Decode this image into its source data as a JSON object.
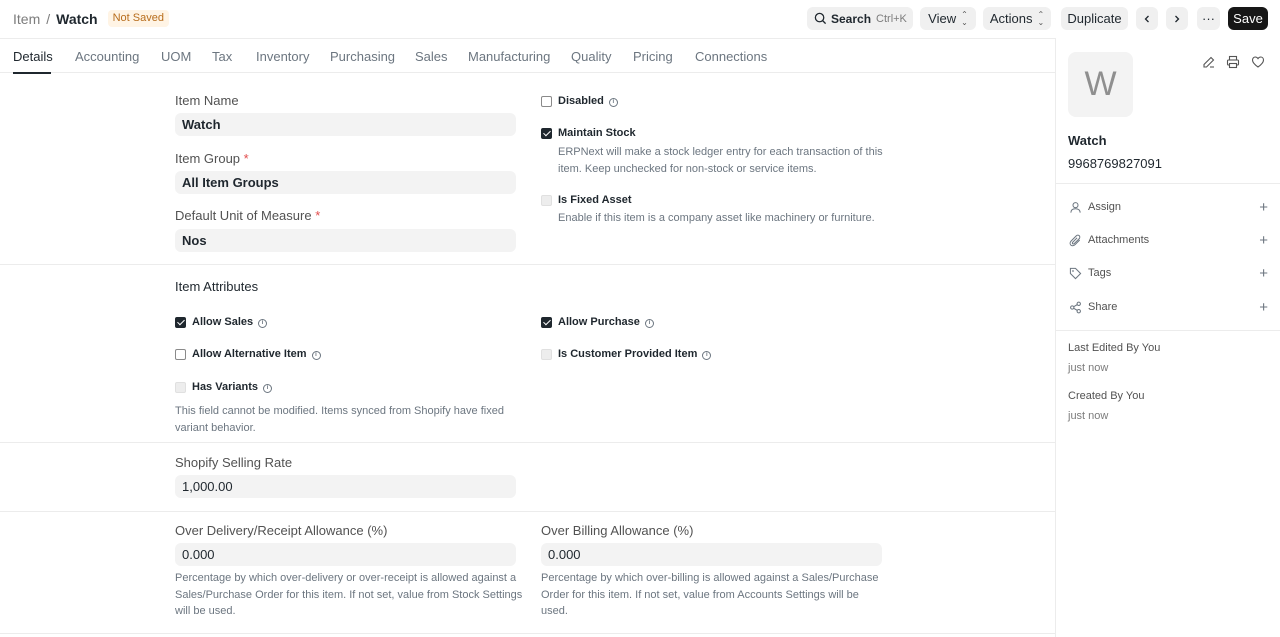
{
  "breadcrumb": {
    "parent": "Item",
    "separator": "/",
    "current": "Watch",
    "status": "Not Saved"
  },
  "toolbar": {
    "search_label": "Search",
    "search_shortcut": "Ctrl+K",
    "view_label": "View",
    "actions_label": "Actions",
    "duplicate_label": "Duplicate",
    "more_label": "···",
    "save_label": "Save"
  },
  "tabs": [
    "Details",
    "Accounting",
    "UOM",
    "Tax",
    "Inventory",
    "Purchasing",
    "Sales",
    "Manufacturing",
    "Quality",
    "Pricing",
    "Connections"
  ],
  "form": {
    "item_name": {
      "label": "Item Name",
      "value": "Watch"
    },
    "item_group": {
      "label": "Item Group",
      "value": "All Item Groups"
    },
    "default_uom": {
      "label": "Default Unit of Measure",
      "value": "Nos"
    },
    "disabled": {
      "label": "Disabled",
      "checked": false
    },
    "maintain_stock": {
      "label": "Maintain Stock",
      "checked": true,
      "desc": "ERPNext will make a stock ledger entry for each transaction of this item. Keep unchecked for non-stock or service items."
    },
    "is_fixed_asset": {
      "label": "Is Fixed Asset",
      "checked": false,
      "desc": "Enable if this item is a company asset like machinery or furniture."
    },
    "attributes_title": "Item Attributes",
    "allow_sales": {
      "label": "Allow Sales",
      "checked": true
    },
    "allow_purchase": {
      "label": "Allow Purchase",
      "checked": true
    },
    "allow_alternative": {
      "label": "Allow Alternative Item",
      "checked": false
    },
    "customer_provided": {
      "label": "Is Customer Provided Item",
      "checked": false
    },
    "has_variants": {
      "label": "Has Variants",
      "checked": false,
      "desc": "This field cannot be modified. Items synced from Shopify have fixed variant behavior."
    },
    "shopify_rate": {
      "label": "Shopify Selling Rate",
      "value": "1,000.00"
    },
    "over_delivery": {
      "label": "Over Delivery/Receipt Allowance (%)",
      "value": "0.000",
      "desc": "Percentage by which over-delivery or over-receipt is allowed against a Sales/Purchase Order for this item. If not set, value from Stock Settings will be used."
    },
    "over_billing": {
      "label": "Over Billing Allowance (%)",
      "value": "0.000",
      "desc": "Percentage by which over-billing is allowed against a Sales/Purchase Order for this item. If not set, value from Accounts Settings will be used."
    }
  },
  "sidebar": {
    "avatar_letter": "W",
    "title": "Watch",
    "code": "9968769827091",
    "actions": [
      "Assign",
      "Attachments",
      "Tags",
      "Share"
    ],
    "last_edited": {
      "label": "Last Edited By You",
      "time": "just now"
    },
    "created": {
      "label": "Created By You",
      "time": "just now"
    }
  }
}
